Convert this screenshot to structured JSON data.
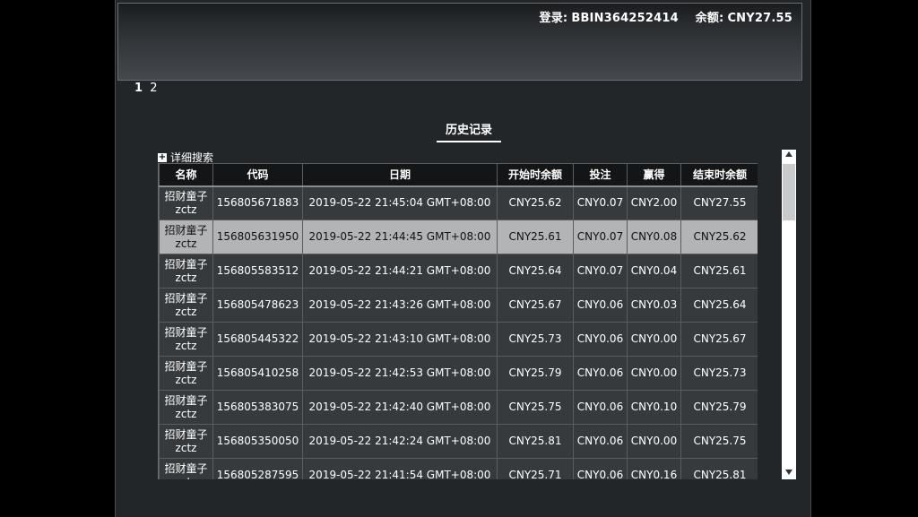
{
  "account": {
    "login_label": "登录:",
    "login_value": "BBIN364252414",
    "balance_label": "余额:",
    "balance_value": "CNY27.55"
  },
  "pager": {
    "pages": [
      "1",
      "2"
    ],
    "active": "1"
  },
  "history_title": "历史记录",
  "detail_search_label": "详细搜索",
  "table": {
    "headers": [
      "名称",
      "代码",
      "日期",
      "开始时余额",
      "投注",
      "赢得",
      "结束时余额"
    ],
    "rows": [
      {
        "name": "招财童子",
        "sub": "zctz",
        "code": "156805671883",
        "date": "2019-05-22 21:45:04 GMT+08:00",
        "start": "CNY25.62",
        "bet": "CNY0.07",
        "win": "CNY2.00",
        "end": "CNY27.55"
      },
      {
        "name": "招财童子",
        "sub": "zctz",
        "code": "156805631950",
        "date": "2019-05-22 21:44:45 GMT+08:00",
        "start": "CNY25.61",
        "bet": "CNY0.07",
        "win": "CNY0.08",
        "end": "CNY25.62"
      },
      {
        "name": "招财童子",
        "sub": "zctz",
        "code": "156805583512",
        "date": "2019-05-22 21:44:21 GMT+08:00",
        "start": "CNY25.64",
        "bet": "CNY0.07",
        "win": "CNY0.04",
        "end": "CNY25.61"
      },
      {
        "name": "招财童子",
        "sub": "zctz",
        "code": "156805478623",
        "date": "2019-05-22 21:43:26 GMT+08:00",
        "start": "CNY25.67",
        "bet": "CNY0.06",
        "win": "CNY0.03",
        "end": "CNY25.64"
      },
      {
        "name": "招财童子",
        "sub": "zctz",
        "code": "156805445322",
        "date": "2019-05-22 21:43:10 GMT+08:00",
        "start": "CNY25.73",
        "bet": "CNY0.06",
        "win": "CNY0.00",
        "end": "CNY25.67"
      },
      {
        "name": "招财童子",
        "sub": "zctz",
        "code": "156805410258",
        "date": "2019-05-22 21:42:53 GMT+08:00",
        "start": "CNY25.79",
        "bet": "CNY0.06",
        "win": "CNY0.00",
        "end": "CNY25.73"
      },
      {
        "name": "招财童子",
        "sub": "zctz",
        "code": "156805383075",
        "date": "2019-05-22 21:42:40 GMT+08:00",
        "start": "CNY25.75",
        "bet": "CNY0.06",
        "win": "CNY0.10",
        "end": "CNY25.79"
      },
      {
        "name": "招财童子",
        "sub": "zctz",
        "code": "156805350050",
        "date": "2019-05-22 21:42:24 GMT+08:00",
        "start": "CNY25.81",
        "bet": "CNY0.06",
        "win": "CNY0.00",
        "end": "CNY25.75"
      },
      {
        "name": "招财童子",
        "sub": "zctz",
        "code": "156805287595",
        "date": "2019-05-22 21:41:54 GMT+08:00",
        "start": "CNY25.71",
        "bet": "CNY0.06",
        "win": "CNY0.16",
        "end": "CNY25.81"
      }
    ],
    "selected_row": 1
  },
  "icons": {
    "detail_search": "plus-box-icon",
    "scroll_up": "triangle-up-icon",
    "scroll_down": "triangle-down-icon"
  }
}
